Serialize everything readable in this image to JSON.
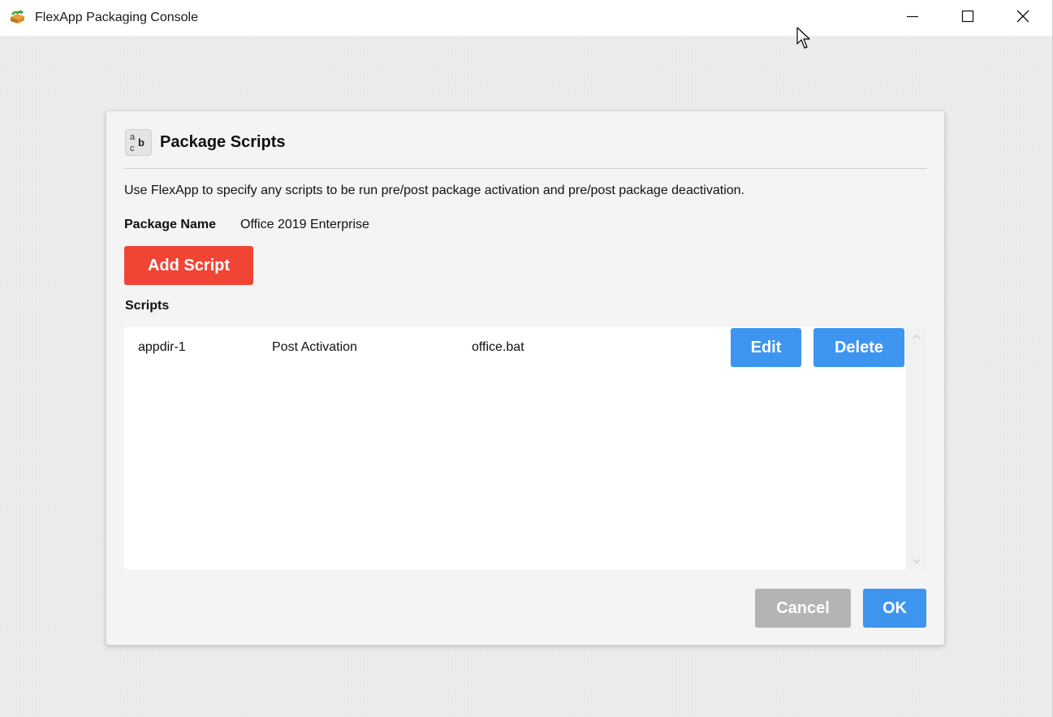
{
  "window": {
    "title": "FlexApp Packaging Console"
  },
  "icons": {
    "app": "flexapp-logo-icon",
    "minimize": "minimize-icon",
    "maximize": "maximize-icon",
    "close": "close-icon",
    "header": "script-abc-icon",
    "header_glyph_a": "a",
    "header_glyph_b": "b",
    "header_glyph_c": "c",
    "cursor": "mouse-pointer-icon",
    "scroll_up": "chevron-up-icon",
    "scroll_down": "chevron-down-icon"
  },
  "dialog": {
    "title": "Package Scripts",
    "description": "Use FlexApp to specify any scripts to be run pre/post package activation and pre/post package deactivation.",
    "package_name_label": "Package Name",
    "package_name_value": "Office 2019 Enterprise",
    "add_script_label": "Add Script",
    "scripts_label": "Scripts",
    "scripts": [
      {
        "name": "appdir-1",
        "type": "Post Activation",
        "file": "office.bat",
        "edit_label": "Edit",
        "delete_label": "Delete"
      }
    ],
    "cancel_label": "Cancel",
    "ok_label": "OK"
  },
  "colors": {
    "add_button": "#f04535",
    "primary_button": "#3d95f0",
    "disabled_button": "#b4b4b4"
  }
}
